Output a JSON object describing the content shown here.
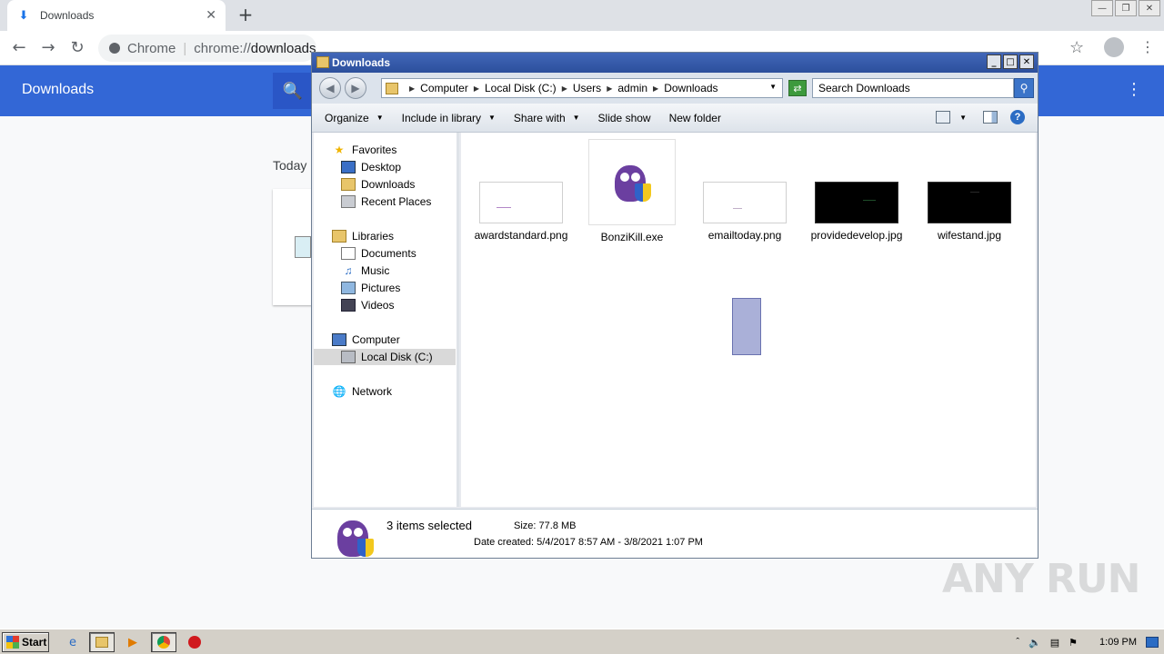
{
  "browser": {
    "tab_title": "Downloads",
    "omnibox_site": "Chrome",
    "omnibox_url_prefix": "chrome://",
    "omnibox_url_path": "downloads",
    "page_header_title": "Downloads",
    "section_label": "Today",
    "accent_color": "#3367d6"
  },
  "explorer": {
    "title": "Downloads",
    "breadcrumbs": [
      "Computer",
      "Local Disk (C:)",
      "Users",
      "admin",
      "Downloads"
    ],
    "search_placeholder": "Search Downloads",
    "commands": [
      {
        "label": "Organize",
        "has_menu": true
      },
      {
        "label": "Include in library",
        "has_menu": true
      },
      {
        "label": "Share with",
        "has_menu": true
      },
      {
        "label": "Slide show",
        "has_menu": false
      },
      {
        "label": "New folder",
        "has_menu": false
      }
    ],
    "nav": {
      "favorites": "Favorites",
      "desktop": "Desktop",
      "downloads": "Downloads",
      "recent_places": "Recent Places",
      "libraries": "Libraries",
      "documents": "Documents",
      "music": "Music",
      "pictures": "Pictures",
      "videos": "Videos",
      "computer": "Computer",
      "local_disk": "Local Disk (C:)",
      "network": "Network"
    },
    "files": [
      {
        "name": "awardstandard.png",
        "kind": "png-light"
      },
      {
        "name": "BonziKill.exe",
        "kind": "exe-bonzi"
      },
      {
        "name": "emailtoday.png",
        "kind": "png-light"
      },
      {
        "name": "providedevelop.jpg",
        "kind": "jpg-dark"
      },
      {
        "name": "wifestand.jpg",
        "kind": "jpg-dark"
      }
    ],
    "details": {
      "selection_count": "3 items selected",
      "size_label": "Size:",
      "size_value": "77.8 MB",
      "date_label": "Date created:",
      "date_value": "5/4/2017 8:57 AM - 3/8/2021 1:07 PM"
    }
  },
  "taskbar": {
    "start_label": "Start",
    "clock": "1:09 PM"
  },
  "watermark": "ANY RUN"
}
